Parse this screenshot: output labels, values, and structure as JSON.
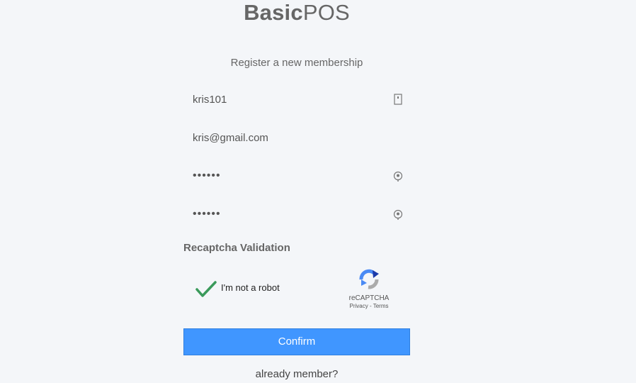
{
  "logo": {
    "bold": "Basic",
    "light": "POS"
  },
  "box_msg": "Register a new membership",
  "fields": {
    "username": {
      "value": "kris101",
      "icon": "id-card-icon"
    },
    "email": {
      "value": "kris@gmail.com"
    },
    "password": {
      "value": "••••••",
      "icon": "lock-icon"
    },
    "password_confirm": {
      "value": "••••••",
      "icon": "lock-icon"
    }
  },
  "captcha": {
    "title": "Recaptcha Validation",
    "label": "I'm not a robot",
    "checked": true,
    "brand": "reCAPTCHA",
    "links": "Privacy - Terms",
    "check_color": "#3a9a5b"
  },
  "confirm_label": "Confirm",
  "member_link": "already member?",
  "colors": {
    "accent": "#4096ff",
    "background": "#f4f6f9"
  }
}
